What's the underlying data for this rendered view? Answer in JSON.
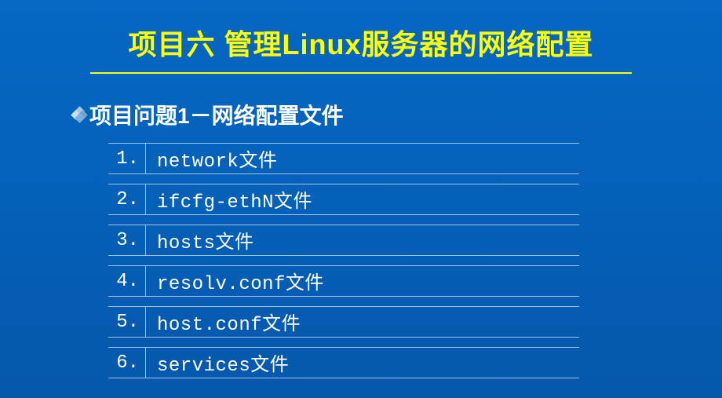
{
  "title": "项目六   管理Linux服务器的网络配置",
  "subtitle": "项目问题1－网络配置文件",
  "items": [
    {
      "num": "1.",
      "text": "network文件"
    },
    {
      "num": "2.",
      "text": "ifcfg-ethN文件"
    },
    {
      "num": "3.",
      "text": "hosts文件"
    },
    {
      "num": "4.",
      "text": "resolv.conf文件"
    },
    {
      "num": "5.",
      "text": "host.conf文件"
    },
    {
      "num": "6.",
      "text": "services文件"
    }
  ]
}
